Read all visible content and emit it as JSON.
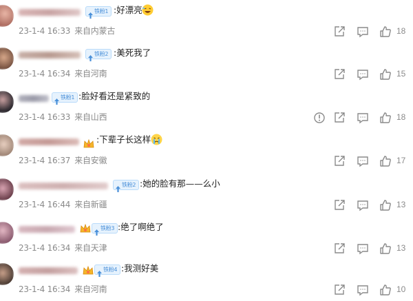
{
  "comments": [
    {
      "badge": "铁粉1",
      "text": ":好漂亮",
      "date": "23-1-4 16:33",
      "place": "来自内蒙古",
      "likes": "18",
      "has_report": false
    },
    {
      "badge": "铁粉2",
      "text": ":美死我了",
      "date": "23-1-4 16:34",
      "place": "来自河南",
      "likes": "15",
      "has_report": false
    },
    {
      "badge": "铁粉1",
      "text": ":脸好看还是紧致的",
      "date": "23-1-4 16:33",
      "place": "来自山西",
      "likes": "18",
      "has_report": true
    },
    {
      "badge": "",
      "text": ":下辈子长这样",
      "date": "23-1-4 16:37",
      "place": "来自安徽",
      "likes": "17",
      "has_report": false
    },
    {
      "badge": "铁粉2",
      "text": ":她的脸有那——么小",
      "date": "23-1-4 16:44",
      "place": "来自新疆",
      "likes": "13",
      "has_report": false
    },
    {
      "badge": "铁粉3",
      "text": ":绝了啊绝了",
      "date": "23-1-4 16:34",
      "place": "来自天津",
      "likes": "13",
      "has_report": false
    },
    {
      "badge": "铁粉4",
      "text": ":我测好美",
      "date": "23-1-4 16:34",
      "place": "来自河南",
      "likes": "10",
      "has_report": false
    }
  ],
  "colors": {
    "badge_text": "#4a90d9",
    "badge_bg": "#e6f2fd",
    "meta_text": "#8a8a8a",
    "icon": "#8a8a8a"
  },
  "icons": {
    "share": "share-icon",
    "reply": "comment-icon",
    "like": "thumbs-up-icon",
    "report": "report-icon"
  }
}
